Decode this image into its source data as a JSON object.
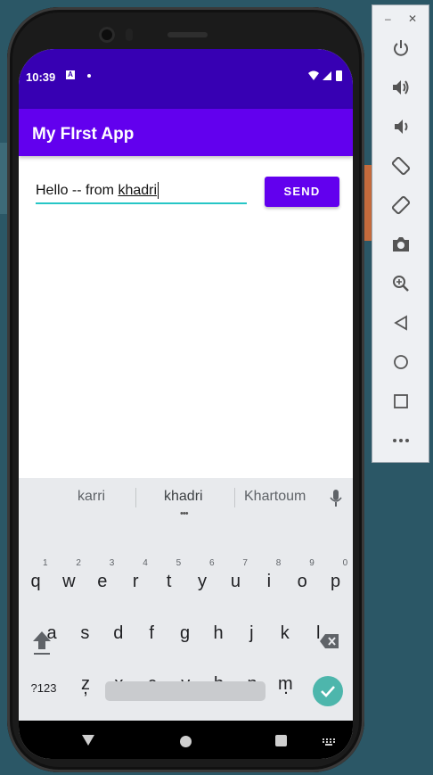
{
  "status": {
    "time": "10:39",
    "notif_letter": "A"
  },
  "app": {
    "title": "My FIrst App"
  },
  "message": {
    "prefix": "Hello -- from ",
    "word": "khadri"
  },
  "send_label": "SEND",
  "keyboard": {
    "suggestions": [
      "karri",
      "khadri",
      "Khartoum"
    ],
    "row1": [
      {
        "k": "q",
        "h": "1"
      },
      {
        "k": "w",
        "h": "2"
      },
      {
        "k": "e",
        "h": "3"
      },
      {
        "k": "r",
        "h": "4"
      },
      {
        "k": "t",
        "h": "5"
      },
      {
        "k": "y",
        "h": "6"
      },
      {
        "k": "u",
        "h": "7"
      },
      {
        "k": "i",
        "h": "8"
      },
      {
        "k": "o",
        "h": "9"
      },
      {
        "k": "p",
        "h": "0"
      }
    ],
    "row2": [
      "a",
      "s",
      "d",
      "f",
      "g",
      "h",
      "j",
      "k",
      "l"
    ],
    "row3": [
      "z",
      "x",
      "c",
      "v",
      "b",
      "n",
      "m"
    ],
    "symbols_label": "?123",
    "comma": ",",
    "period": "."
  },
  "colors": {
    "primary": "#6200ee",
    "primary_dark": "#3700b3",
    "accent": "#26c6c6"
  },
  "toolbar": {
    "buttons": [
      "power-icon",
      "volume-up-icon",
      "volume-down-icon",
      "rotate-left-icon",
      "rotate-right-icon",
      "camera-icon",
      "zoom-icon",
      "back-icon",
      "home-icon",
      "overview-icon",
      "more-icon"
    ]
  }
}
